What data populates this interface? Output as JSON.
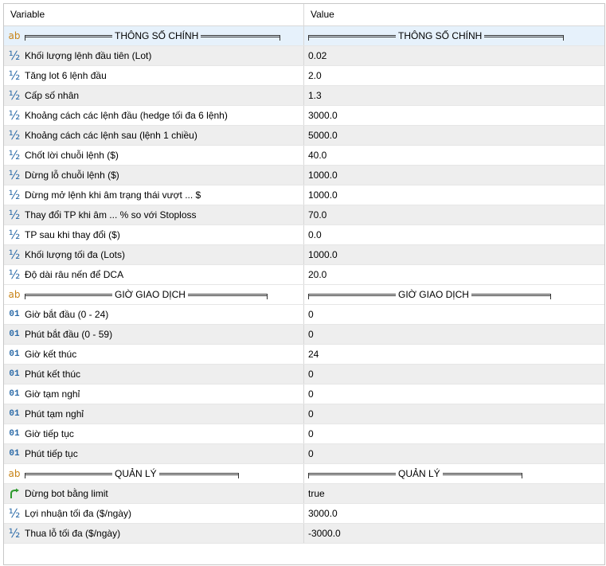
{
  "header": {
    "variable": "Variable",
    "value": "Value"
  },
  "rows": [
    {
      "icon": "ab",
      "label": "THÔNG SỐ CHÍNH",
      "value": "THÔNG SỐ CHÍNH",
      "sep": true
    },
    {
      "icon": "half",
      "label": "Khối lượng lệnh đầu tiên (Lot)",
      "value": "0.02"
    },
    {
      "icon": "half",
      "label": "Tăng lot 6 lệnh đầu",
      "value": "2.0"
    },
    {
      "icon": "half",
      "label": "Cấp số nhân",
      "value": "1.3"
    },
    {
      "icon": "half",
      "label": "Khoảng cách các lệnh đầu (hedge tối đa 6 lệnh)",
      "value": "3000.0"
    },
    {
      "icon": "half",
      "label": "Khoảng cách các lệnh sau (lệnh 1 chiều)",
      "value": "5000.0"
    },
    {
      "icon": "half",
      "label": "Chốt lời chuỗi lệnh ($)",
      "value": "40.0"
    },
    {
      "icon": "half",
      "label": "Dừng lỗ chuỗi lệnh ($)",
      "value": "1000.0"
    },
    {
      "icon": "half",
      "label": "Dừng mở lệnh khi âm trạng thái vượt ... $",
      "value": "1000.0"
    },
    {
      "icon": "half",
      "label": "Thay đổi TP khi âm ... % so với Stoploss",
      "value": "70.0"
    },
    {
      "icon": "half",
      "label": "TP sau khi thay đổi ($)",
      "value": "0.0"
    },
    {
      "icon": "half",
      "label": "Khối lượng tối đa (Lots)",
      "value": "1000.0"
    },
    {
      "icon": "half",
      "label": "Độ dài râu nến để DCA",
      "value": "20.0"
    },
    {
      "icon": "ab",
      "label": "GIỜ GIAO DỊCH",
      "value": "GIỜ GIAO DỊCH",
      "sep": true
    },
    {
      "icon": "num",
      "label": "Giờ bắt đầu (0 - 24)",
      "value": "0"
    },
    {
      "icon": "num",
      "label": "Phút bắt đầu (0 - 59)",
      "value": "0"
    },
    {
      "icon": "num",
      "label": "Giờ kết thúc",
      "value": "24"
    },
    {
      "icon": "num",
      "label": "Phút kết thúc",
      "value": "0"
    },
    {
      "icon": "num",
      "label": "Giờ tạm nghỉ",
      "value": "0"
    },
    {
      "icon": "num",
      "label": "Phút tạm nghỉ",
      "value": "0"
    },
    {
      "icon": "num",
      "label": "Giờ tiếp tục",
      "value": "0"
    },
    {
      "icon": "num",
      "label": "Phút tiếp tục",
      "value": "0"
    },
    {
      "icon": "ab",
      "label": "QUẢN LÝ",
      "value": "QUẢN LÝ",
      "sep": true
    },
    {
      "icon": "arrow",
      "label": "Dừng bot bằng limit",
      "value": "true"
    },
    {
      "icon": "half",
      "label": "Lợi nhuận tối đa ($/ngày)",
      "value": "3000.0"
    },
    {
      "icon": "half",
      "label": "Thua lỗ tối đa ($/ngày)",
      "value": "-3000.0"
    }
  ],
  "icons": {
    "half": {
      "name": "fraction-half-icon",
      "glyph": "½"
    },
    "num": {
      "name": "integer-icon",
      "glyph": "01"
    },
    "ab": {
      "name": "string-icon",
      "glyph": "ab"
    },
    "arrow": {
      "name": "boolean-arrow-icon",
      "glyph": ""
    }
  },
  "colors": {
    "accent": "#2a6aa8",
    "string_icon": "#c88418",
    "bool_icon": "#2e9a2e",
    "row_alt": "#eeeeee",
    "row_selected": "#e6f1fb"
  }
}
